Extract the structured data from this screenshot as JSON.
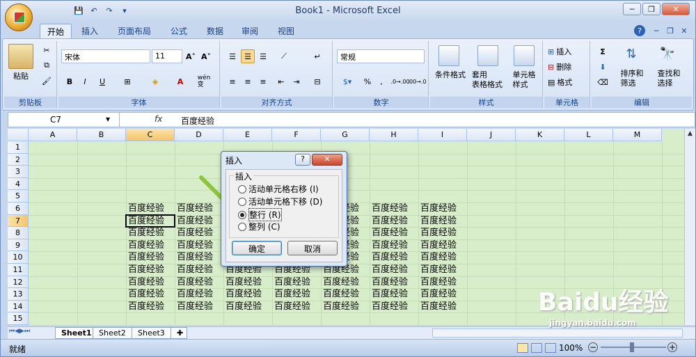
{
  "window": {
    "title": "Book1 - Microsoft Excel",
    "controls": {
      "minimize": "─",
      "restore": "❐",
      "close": "✕"
    },
    "doc_controls": {
      "help": "?",
      "minimize": "─",
      "restore": "❐",
      "close": "✕"
    }
  },
  "qat": {
    "save": "💾",
    "undo": "↶",
    "redo": "↷",
    "more": "▾"
  },
  "tabs": [
    "开始",
    "插入",
    "页面布局",
    "公式",
    "数据",
    "审阅",
    "视图"
  ],
  "ribbon": {
    "clipboard": {
      "label": "剪贴板",
      "paste": "粘贴",
      "cut": "✂",
      "copy": "⧉",
      "painter": "🖌"
    },
    "font": {
      "label": "字体",
      "name": "宋体",
      "size": "11",
      "grow": "A˄",
      "shrink": "A˅",
      "bold": "B",
      "italic": "I",
      "underline": "U",
      "border": "⊞",
      "fill": "◈",
      "color": "A",
      "phonetic": "wén\n变"
    },
    "align": {
      "label": "对齐方式"
    },
    "number": {
      "label": "数字",
      "format": "常规",
      "percent": "%",
      "comma": ",",
      "inc": ".0→.00",
      "dec": ".00→.0"
    },
    "styles": {
      "label": "样式",
      "cond": "条件格式",
      "table_fmt": "套用\n表格格式",
      "cell_style": "单元格\n样式"
    },
    "cells": {
      "label": "单元格",
      "insert": "插入",
      "delete": "删除",
      "format": "格式"
    },
    "editing": {
      "label": "编辑",
      "sum": "Σ",
      "sort": "排序和\n筛选",
      "find": "查找和\n选择"
    }
  },
  "formula_bar": {
    "name_box": "C7",
    "fx": "fx",
    "value": "百度经验"
  },
  "columns": [
    "A",
    "B",
    "C",
    "D",
    "E",
    "F",
    "G",
    "H",
    "I",
    "J",
    "K",
    "L",
    "M"
  ],
  "rows": [
    "1",
    "2",
    "3",
    "4",
    "5",
    "6",
    "7",
    "8",
    "9",
    "10",
    "11",
    "12",
    "13",
    "14",
    "15"
  ],
  "cell_text": "百度经验",
  "sheet_tabs": [
    "Sheet1",
    "Sheet2",
    "Sheet3"
  ],
  "status": {
    "left": "就绪",
    "zoom": "100%"
  },
  "dialog": {
    "title": "插入",
    "help": "?",
    "close": "✕",
    "group_label": "插入",
    "options": [
      {
        "label": "活动单元格右移 (I)",
        "selected": false
      },
      {
        "label": "活动单元格下移 (D)",
        "selected": false
      },
      {
        "label": "整行 (R)",
        "selected": true
      },
      {
        "label": "整列 (C)",
        "selected": false
      }
    ],
    "ok": "确定",
    "cancel": "取消"
  },
  "watermark": {
    "text": "Baidu经验",
    "url": "jingyan.baidu.com"
  }
}
